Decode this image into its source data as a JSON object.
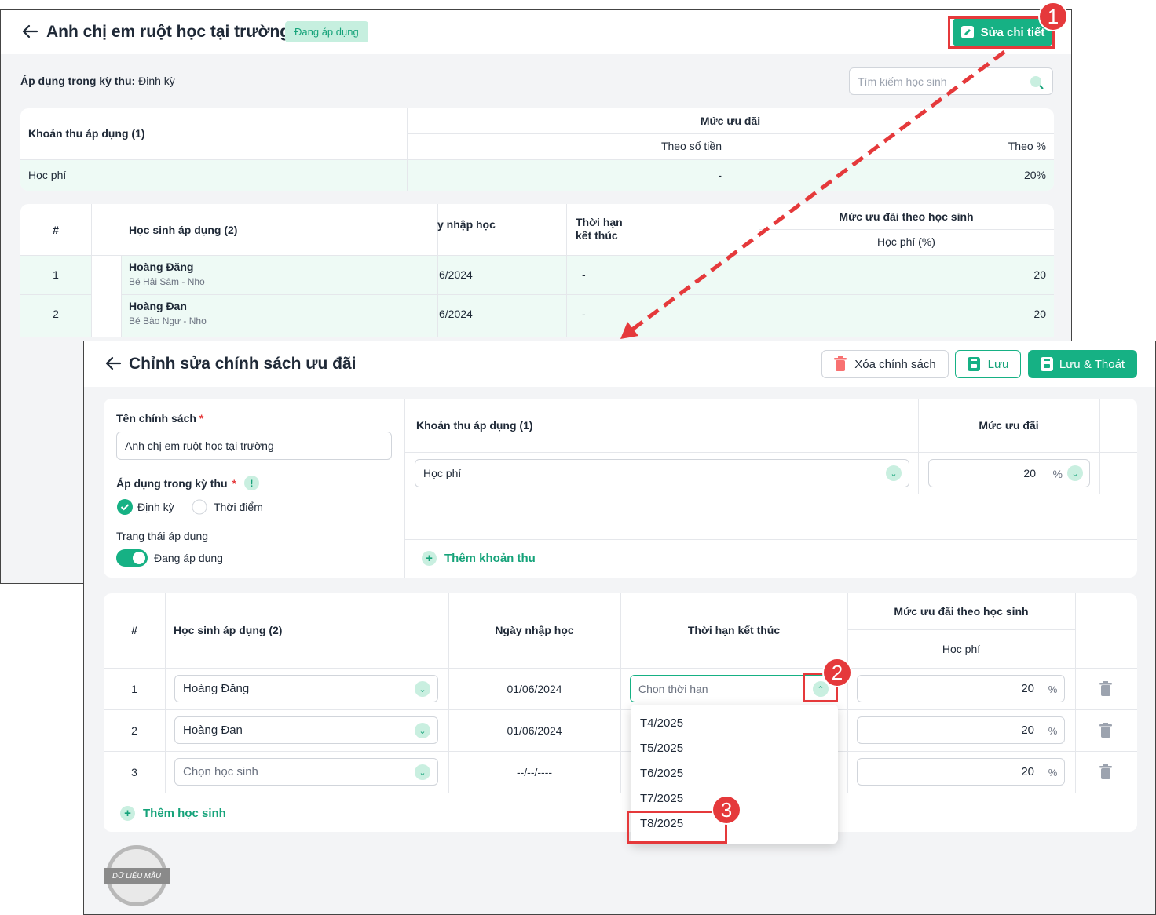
{
  "back": {
    "title": "Anh chị em ruột học tại trường",
    "status_badge": "Đang áp dụng",
    "edit_button": "Sửa chi tiết",
    "period_label": "Áp dụng trong kỳ thu:",
    "period_value": "Định kỳ",
    "search_placeholder": "Tìm kiếm học sinh",
    "fee_table": {
      "col_fee": "Khoản thu áp dụng (1)",
      "col_discount": "Mức ưu đãi",
      "col_amount": "Theo số tiền",
      "col_percent": "Theo %",
      "row": {
        "fee": "Học phí",
        "amount": "-",
        "percent": "20%"
      }
    },
    "student_table": {
      "col_num": "#",
      "col_student": "Học sinh áp dụng (2)",
      "col_enroll": "y nhập học",
      "col_end": "Thời hạn\nkết thúc",
      "col_discount": "Mức ưu đãi theo học sinh",
      "col_fee": "Học phí (%)",
      "rows": [
        {
          "num": "1",
          "name": "Hoàng Đăng",
          "class": "Bé Hải Sâm - Nho",
          "enroll": "6/2024",
          "end": "-",
          "value": "20"
        },
        {
          "num": "2",
          "name": "Hoàng Đan",
          "class": "Bé Bào Ngư - Nho",
          "enroll": "6/2024",
          "end": "-",
          "value": "20"
        }
      ]
    }
  },
  "front": {
    "title": "Chỉnh sửa chính sách ưu đãi",
    "delete_button": "Xóa chính sách",
    "save_button": "Lưu",
    "save_exit_button": "Lưu & Thoát",
    "form": {
      "name_label": "Tên chính sách",
      "required": "*",
      "name_value": "Anh chị em ruột học tại trường",
      "period_label": "Áp dụng trong kỳ thu",
      "info": "!",
      "option_periodic": "Định kỳ",
      "option_point": "Thời điểm",
      "status_label": "Trạng thái áp dụng",
      "status_value": "Đang áp dụng"
    },
    "fee_section": {
      "col_fee": "Khoản thu áp dụng (1)",
      "col_discount": "Mức ưu đãi",
      "fee_value": "Học phí",
      "discount_value": "20",
      "unit": "%",
      "add_fee": "Thêm khoản thu"
    },
    "student_table": {
      "col_num": "#",
      "col_student": "Học sinh áp dụng (2)",
      "col_enroll": "Ngày nhập học",
      "col_end": "Thời hạn kết thúc",
      "col_discount": "Mức ưu đãi theo học sinh",
      "col_fee": "Học phí",
      "unit": "%",
      "end_placeholder": "Chọn thời hạn",
      "rows": [
        {
          "num": "1",
          "student": "Hoàng Đăng",
          "enroll": "01/06/2024",
          "value": "20"
        },
        {
          "num": "2",
          "student": "Hoàng Đan",
          "enroll": "01/06/2024",
          "value": "20"
        },
        {
          "num": "3",
          "student": "Chọn học sinh",
          "enroll": "--/--/----",
          "value": "20"
        }
      ],
      "add_student": "Thêm học sinh"
    },
    "dropdown_options": [
      "T4/2025",
      "T5/2025",
      "T6/2025",
      "T7/2025",
      "T8/2025"
    ],
    "stamp": "DỮ LIỆU MẪU"
  },
  "annotations": [
    "1",
    "2",
    "3"
  ]
}
